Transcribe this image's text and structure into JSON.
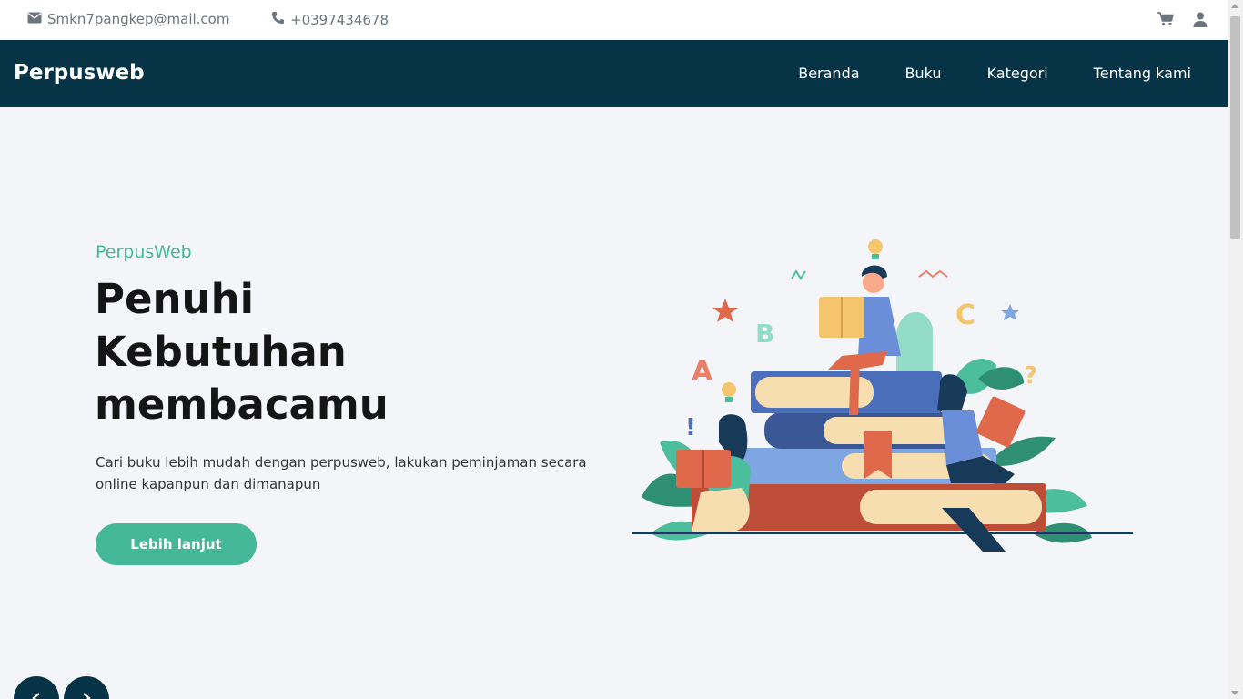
{
  "topbar": {
    "email": "Smkn7pangkep@mail.com",
    "phone": "+0397434678",
    "icons": [
      "envelope-icon",
      "phone-icon",
      "cart-icon",
      "user-icon"
    ]
  },
  "navbar": {
    "brand": "Perpusweb",
    "links": [
      "Beranda",
      "Buku",
      "Kategori",
      "Tentang kami"
    ]
  },
  "hero": {
    "eyebrow": "PerpusWeb",
    "headline": "Penuhi Kebutuhan membacamu",
    "description": "Cari buku lebih mudah dengan perpusweb, lakukan peminjaman secara online kapanpun dan dimanapun",
    "cta_label": "Lebih lanjut"
  },
  "carousel": {
    "icons": [
      "chevron-left-icon",
      "chevron-right-icon"
    ]
  },
  "colors": {
    "navbar": "#063346",
    "accent": "#45b89a",
    "background": "#f4f5f9"
  }
}
